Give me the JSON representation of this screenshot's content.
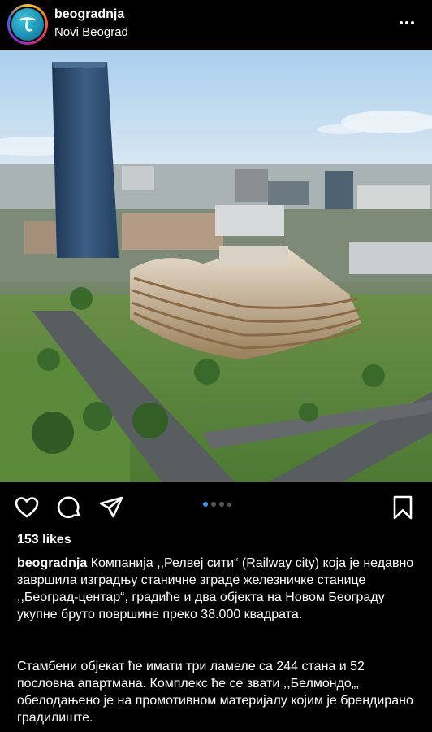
{
  "post": {
    "username": "beogradnja",
    "location": "Novi Beograd",
    "likes": "153 likes",
    "caption_user": "beogradnja",
    "caption_text_1": "Компанија ,,Релвеј сити“ (Railway city) која је недавно завршила изградњу станичне зграде железничке станице ,,Београд-центар“, градиће и два објекта на Новом Београду укупне бруто површине преко 38.000 квадрата.",
    "caption_text_2": "Стамбени објекат ће имати три ламеле са 244 стана и 52 пословна апартмана. Комплекс ће се звати ,,Белмондо„, обелодањено је на промотивном материјалу којим је брендирано градилиште."
  },
  "carousel": {
    "count": 4,
    "active_index": 0
  },
  "icons": {
    "avatar": "brand-logo-t-icon",
    "more": "more-horizontal-icon",
    "like": "heart-outline-icon",
    "comment": "comment-bubble-icon",
    "share": "paper-plane-icon",
    "save": "bookmark-outline-icon"
  },
  "colors": {
    "background": "#000000",
    "text": "#ffffff",
    "active_dot": "#3897f0",
    "inactive_dot": "#555555"
  }
}
